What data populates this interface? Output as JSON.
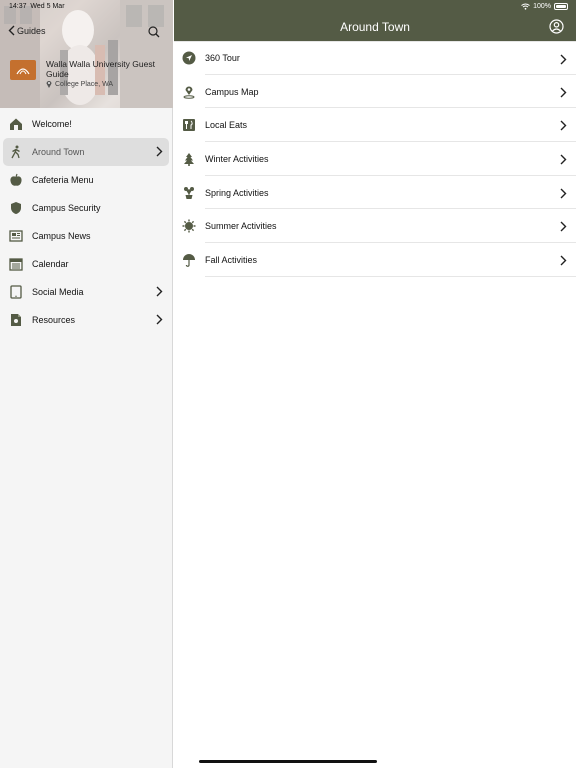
{
  "status_bar": {
    "time": "14:37",
    "date": "Wed 5 Mar",
    "battery": "100%"
  },
  "sidebar": {
    "back_label": "Guides",
    "guide_title": "Walla Walla University Guest Guide",
    "guide_location": "College Place, WA",
    "items": [
      {
        "label": "Welcome!",
        "icon": "home-icon"
      },
      {
        "label": "Around Town",
        "icon": "walking-person-icon"
      },
      {
        "label": "Cafeteria Menu",
        "icon": "apple-icon"
      },
      {
        "label": "Campus Security",
        "icon": "shield-icon"
      },
      {
        "label": "Campus News",
        "icon": "newspaper-icon"
      },
      {
        "label": "Calendar",
        "icon": "calendar-icon"
      },
      {
        "label": "Social Media",
        "icon": "tablet-icon"
      },
      {
        "label": "Resources",
        "icon": "document-icon"
      }
    ]
  },
  "main": {
    "title": "Around Town",
    "items": [
      {
        "label": "360 Tour",
        "icon": "location-arrow-icon"
      },
      {
        "label": "Campus Map",
        "icon": "map-pin-icon"
      },
      {
        "label": "Local Eats",
        "icon": "fork-knife-icon"
      },
      {
        "label": "Winter Activities",
        "icon": "pine-tree-icon"
      },
      {
        "label": "Spring Activities",
        "icon": "flower-pot-icon"
      },
      {
        "label": "Summer Activities",
        "icon": "sun-icon"
      },
      {
        "label": "Fall Activities",
        "icon": "umbrella-icon"
      }
    ]
  },
  "colors": {
    "accent": "#545b45",
    "icon": "#545b45",
    "logo": "#c4702e"
  }
}
